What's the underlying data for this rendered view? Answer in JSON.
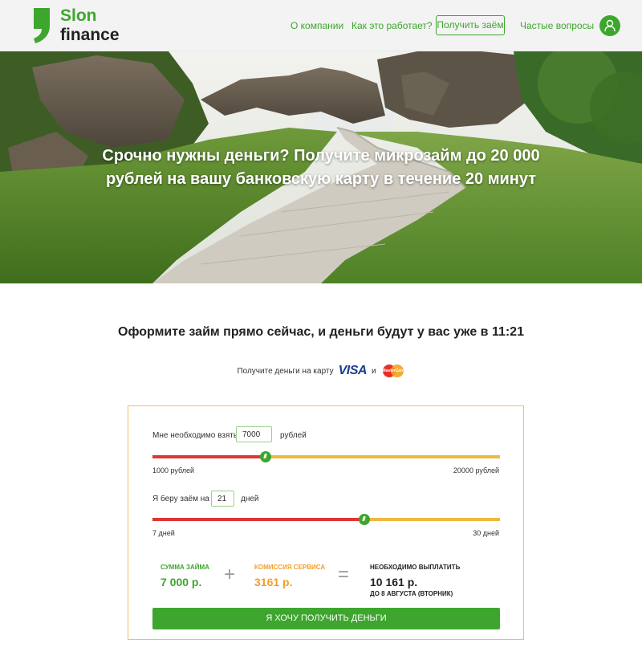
{
  "brand": {
    "line1": "Slon",
    "line2": "finance",
    "color": "#3ea62e"
  },
  "nav": {
    "about": "О компании",
    "how": "Как это работает?",
    "get_loan": "Получить заём",
    "faq": "Частые вопросы",
    "user_icon": "user-icon"
  },
  "hero": {
    "title": "Срочно нужны деньги? Получите микрозайм до 20 000 рублей на вашу банковскую карту в течение 20 минут"
  },
  "main": {
    "subtitle": "Оформите займ прямо сейчас, и деньги будут у вас уже в 11:21",
    "cards_text": "Получите деньги на карту",
    "cards_and": "и",
    "visa": "VISA",
    "mastercard": "MasterCard"
  },
  "calculator": {
    "amount_label": "Мне необходимо взять",
    "amount_value": "7000",
    "amount_unit": "рублей",
    "amount_min": "1000 рублей",
    "amount_max": "20000 рублей",
    "amount_fraction": 0.326,
    "term_label": "Я беру заём на",
    "term_value": "21",
    "term_unit": "дней",
    "term_min": "7 дней",
    "term_max": "30 дней",
    "term_fraction": 0.61,
    "sum_caption": "СУММА ЗАЙМА",
    "sum_value": "7 000 р.",
    "plus": "+",
    "fee_caption": "КОМИССИЯ СЕРВИСА",
    "fee_value": "3161 р.",
    "equals": "=",
    "total_caption": "НЕОБХОДИМО ВЫПЛАТИТЬ",
    "total_value": "10 161 р.",
    "due_date": "ДО 8 АВГУСТА (ВТОРНИК)",
    "cta": "Я ХОЧУ ПОЛУЧИТЬ ДЕНЬГИ",
    "colors": {
      "green": "#3ea62e",
      "orange": "#f0a02a",
      "red": "#e03533",
      "yellow": "#f0b742"
    }
  }
}
